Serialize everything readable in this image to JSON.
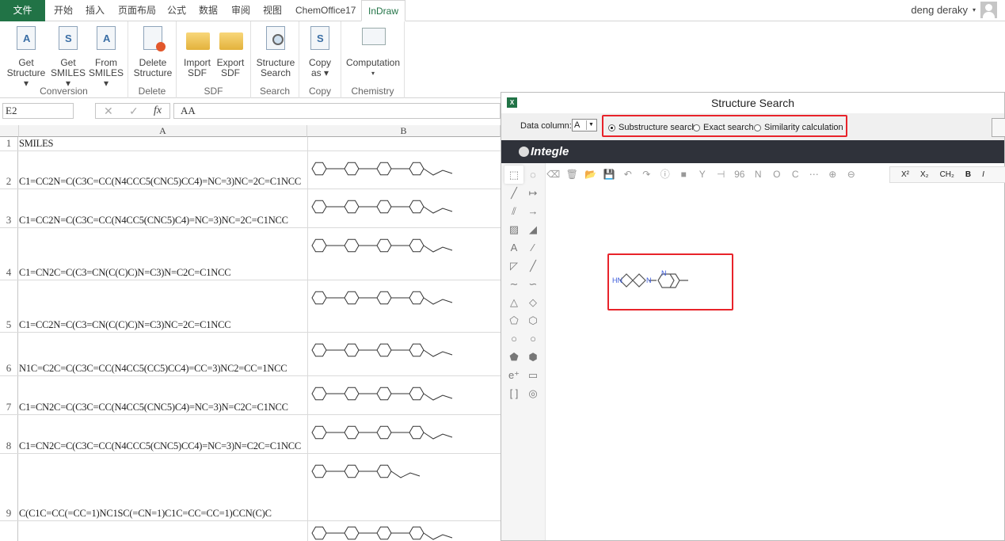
{
  "tabs": {
    "file": "文件",
    "items": [
      "开始",
      "插入",
      "页面布局",
      "公式",
      "数据",
      "审阅",
      "视图",
      "ChemOffice17"
    ],
    "active": "InDraw"
  },
  "user": {
    "name": "deng deraky",
    "caret": "▾"
  },
  "ribbon": {
    "groups": [
      {
        "label": "Conversion",
        "buttons": [
          {
            "l1": "Get",
            "l2": "Structure ▾",
            "glyph": "A"
          },
          {
            "l1": "Get",
            "l2": "SMILES ▾",
            "glyph": "S"
          },
          {
            "l1": "From",
            "l2": "SMILES ▾",
            "glyph": "A"
          }
        ]
      },
      {
        "label": "Delete",
        "buttons": [
          {
            "l1": "Delete",
            "l2": "Structure"
          }
        ]
      },
      {
        "label": "SDF",
        "buttons": [
          {
            "l1": "Import",
            "l2": "SDF"
          },
          {
            "l1": "Export",
            "l2": "SDF"
          }
        ]
      },
      {
        "label": "Search",
        "buttons": [
          {
            "l1": "Structure",
            "l2": "Search"
          }
        ]
      },
      {
        "label": "Copy",
        "buttons": [
          {
            "l1": "Copy",
            "l2": "as ▾",
            "glyph": "S"
          }
        ]
      },
      {
        "label": "Chemistry",
        "buttons": [
          {
            "l1": "Computation",
            "l2": "▾"
          }
        ]
      }
    ]
  },
  "formula_bar": {
    "name_box": "E2",
    "cancel": "✕",
    "enter": "✓",
    "fx": "fx",
    "value": "AA"
  },
  "sheet": {
    "columns": [
      "A",
      "B"
    ],
    "rows": [
      {
        "n": "1",
        "a": "SMILES"
      },
      {
        "n": "2",
        "a": "C1=CC2N=C(C3C=CC(N4CCC5(CNC5)CC4)=NC=3)NC=2C=C1NCC"
      },
      {
        "n": "3",
        "a": "C1=CC2N=C(C3C=CC(N4CC5(CNC5)C4)=NC=3)NC=2C=C1NCC"
      },
      {
        "n": "4",
        "a": "C1=CN2C=C(C3=CN(C(C)C)N=C3)N=C2C=C1NCC"
      },
      {
        "n": "5",
        "a": "C1=CC2N=C(C3=CN(C(C)C)N=C3)NC=2C=C1NCC"
      },
      {
        "n": "6",
        "a": "N1C=C2C=C(C3C=CC(N4CC5(CC5)CC4)=CC=3)NC2=CC=1NCC"
      },
      {
        "n": "7",
        "a": "C1=CN2C=C(C3C=CC(N4CC5(CNC5)C4)=NC=3)N=C2C=C1NCC"
      },
      {
        "n": "8",
        "a": "C1=CN2C=C(C3C=CC(N4CCC5(CNC5)CC4)=NC=3)N=C2C=C1NCC"
      },
      {
        "n": "9",
        "a": "C(C1C=CC(=CC=1)NC1SC(=CN=1)C1C=CC=CC=1)CCN(C)C"
      },
      {
        "n": "",
        "a": ""
      }
    ]
  },
  "dialog": {
    "title": "Structure Search",
    "app_icon": "X",
    "data_column_label": "Data column:",
    "data_column_value": "A",
    "search_modes": [
      {
        "label": "Substructure search",
        "selected": true
      },
      {
        "label": "Exact search",
        "selected": false
      },
      {
        "label": "Similarity calculation",
        "selected": false
      }
    ],
    "brand": "Integle",
    "toolbar": [
      "⌫",
      "🗑",
      "📂",
      "💾",
      "↶",
      "↷",
      "ⓘ",
      "■",
      "Y",
      "⊣",
      "96",
      "N",
      "O",
      "C",
      "⋯",
      "⊕",
      "⊖"
    ],
    "format": [
      "X²",
      "X₂",
      "CH₂",
      "B",
      "I"
    ],
    "left_tools": [
      "⬚",
      "◌",
      "╱",
      "↦",
      "⫽",
      "→",
      "▨",
      "◢",
      "A",
      "∕",
      "◸",
      "╱",
      "∼",
      "∽",
      "△",
      "◇",
      "⬠",
      "⬡",
      "○",
      "○",
      "⬟",
      "⬢",
      "e⁺",
      "▭",
      "[ ]",
      "◎"
    ],
    "query_atoms": {
      "nh": "HN",
      "n1": "N",
      "n2": "N"
    },
    "colors": {
      "accent_red": "#e8232a",
      "dark_band": "#2f323a",
      "excel_green": "#217346",
      "hetero_blue": "#3b5bdb"
    }
  }
}
